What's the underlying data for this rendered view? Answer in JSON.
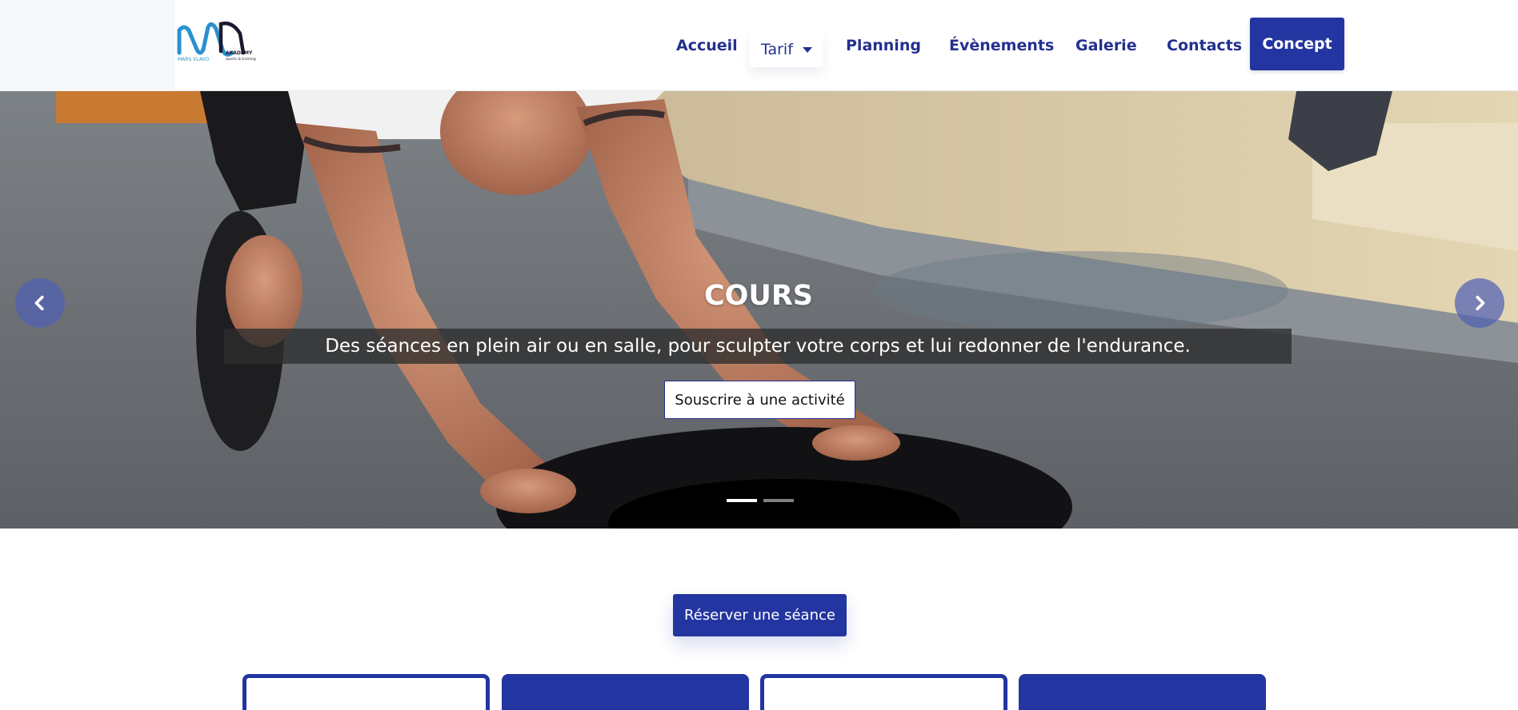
{
  "brand": {
    "logo_text": "MARS VLAVO AKADEMY",
    "logo_tagline": "sports & training",
    "colors": {
      "primary": "#2335a0",
      "nav_text": "#23308f",
      "logo_blue": "#2a90d0",
      "logo_dark": "#1b1b2e"
    }
  },
  "nav": {
    "items": [
      {
        "label": "Accueil"
      },
      {
        "label": "Tarif",
        "has_dropdown": true
      },
      {
        "label": "Planning"
      },
      {
        "label": "Évènements"
      },
      {
        "label": "Galerie"
      },
      {
        "label": "Contacts"
      }
    ],
    "cta_label": "Concept"
  },
  "hero": {
    "title": "COURS",
    "subtitle": "Des séances en plein air ou en salle, pour sculpter votre corps et lui redonner de l'endurance.",
    "button_label": "Souscrire à une activité",
    "slides_count": 2,
    "active_slide": 1,
    "prev_icon": "chevron-left-icon",
    "next_icon": "chevron-right-icon"
  },
  "main": {
    "reserve_label": "Réserver une séance"
  }
}
